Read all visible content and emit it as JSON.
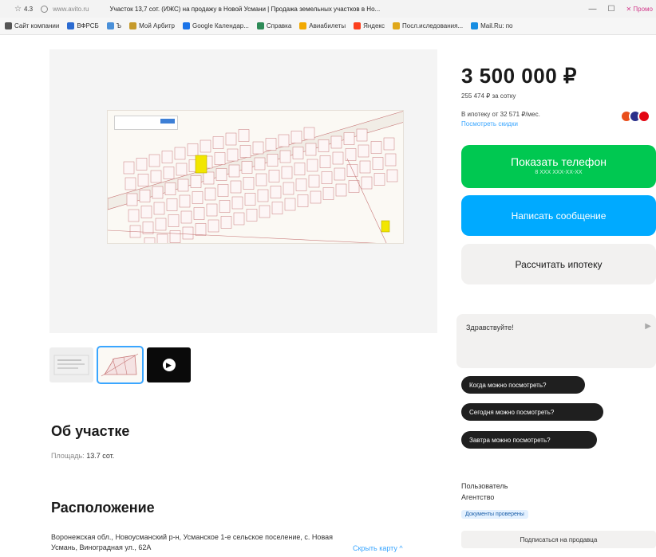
{
  "browser": {
    "rating": "4.3",
    "url": "www.avito.ru",
    "tab_title": "Участок 13,7 сот. (ИЖС) на продажу в Новой Усмани | Продажа земельных участков в Но...",
    "promo": "Промо",
    "bookmarks": [
      {
        "label": "Сайт компании",
        "color": "#555555"
      },
      {
        "label": "ВФРСБ",
        "color": "#2b6bd1"
      },
      {
        "label": "Ъ",
        "color": "#4a90d9"
      },
      {
        "label": "Мой Арбитр",
        "color": "#c69a2b"
      },
      {
        "label": "Google Календар...",
        "color": "#1a73e8"
      },
      {
        "label": "Справка",
        "color": "#2e8b57"
      },
      {
        "label": "Авиабилеты",
        "color": "#f2a900"
      },
      {
        "label": "Яндекс",
        "color": "#fc3f1d"
      },
      {
        "label": "Посл.иследования...",
        "color": "#e0a81a"
      },
      {
        "label": "Mail.Ru: по",
        "color": "#168de2"
      }
    ]
  },
  "listing": {
    "price": "3 500 000 ₽",
    "price_per": "255 474 ₽ за сотку",
    "mortgage": "В ипотеку от 32 571 ₽/мес.",
    "offers_link": "Посмотреть скидки",
    "phone_button": "Показать телефон",
    "phone_masked": "8 XXX XXX-XX-XX",
    "message_button": "Написать сообщение",
    "calc_button": "Рассчитать ипотеку",
    "chat_greeting": "Здравствуйте!",
    "quick_replies": [
      "Когда можно посмотреть?",
      "Сегодня можно посмотреть?",
      "Завтра можно посмотреть?"
    ],
    "seller_name": "Пользователь",
    "seller_type": "Агентство",
    "docs_badge": "Документы проверены",
    "subscribe_button": "Подписаться на продавца",
    "about_heading": "Об участке",
    "area_label": "Площадь:",
    "area_value": "13.7 сот.",
    "location_heading": "Расположение",
    "address": "Воронежская обл., Новоусманский р-н, Усманское 1-е сельское поселение, с. Новая Усмань, Виноградная ул., 62А",
    "hide_map": "Скрыть карту ^"
  },
  "colors": {
    "green": "#00c851",
    "blue": "#00aaff",
    "highlight": "#f2e600",
    "plot_line": "#c87a7a"
  },
  "banks": [
    "#e94e1b",
    "#2a2f8a",
    "#e30613"
  ]
}
